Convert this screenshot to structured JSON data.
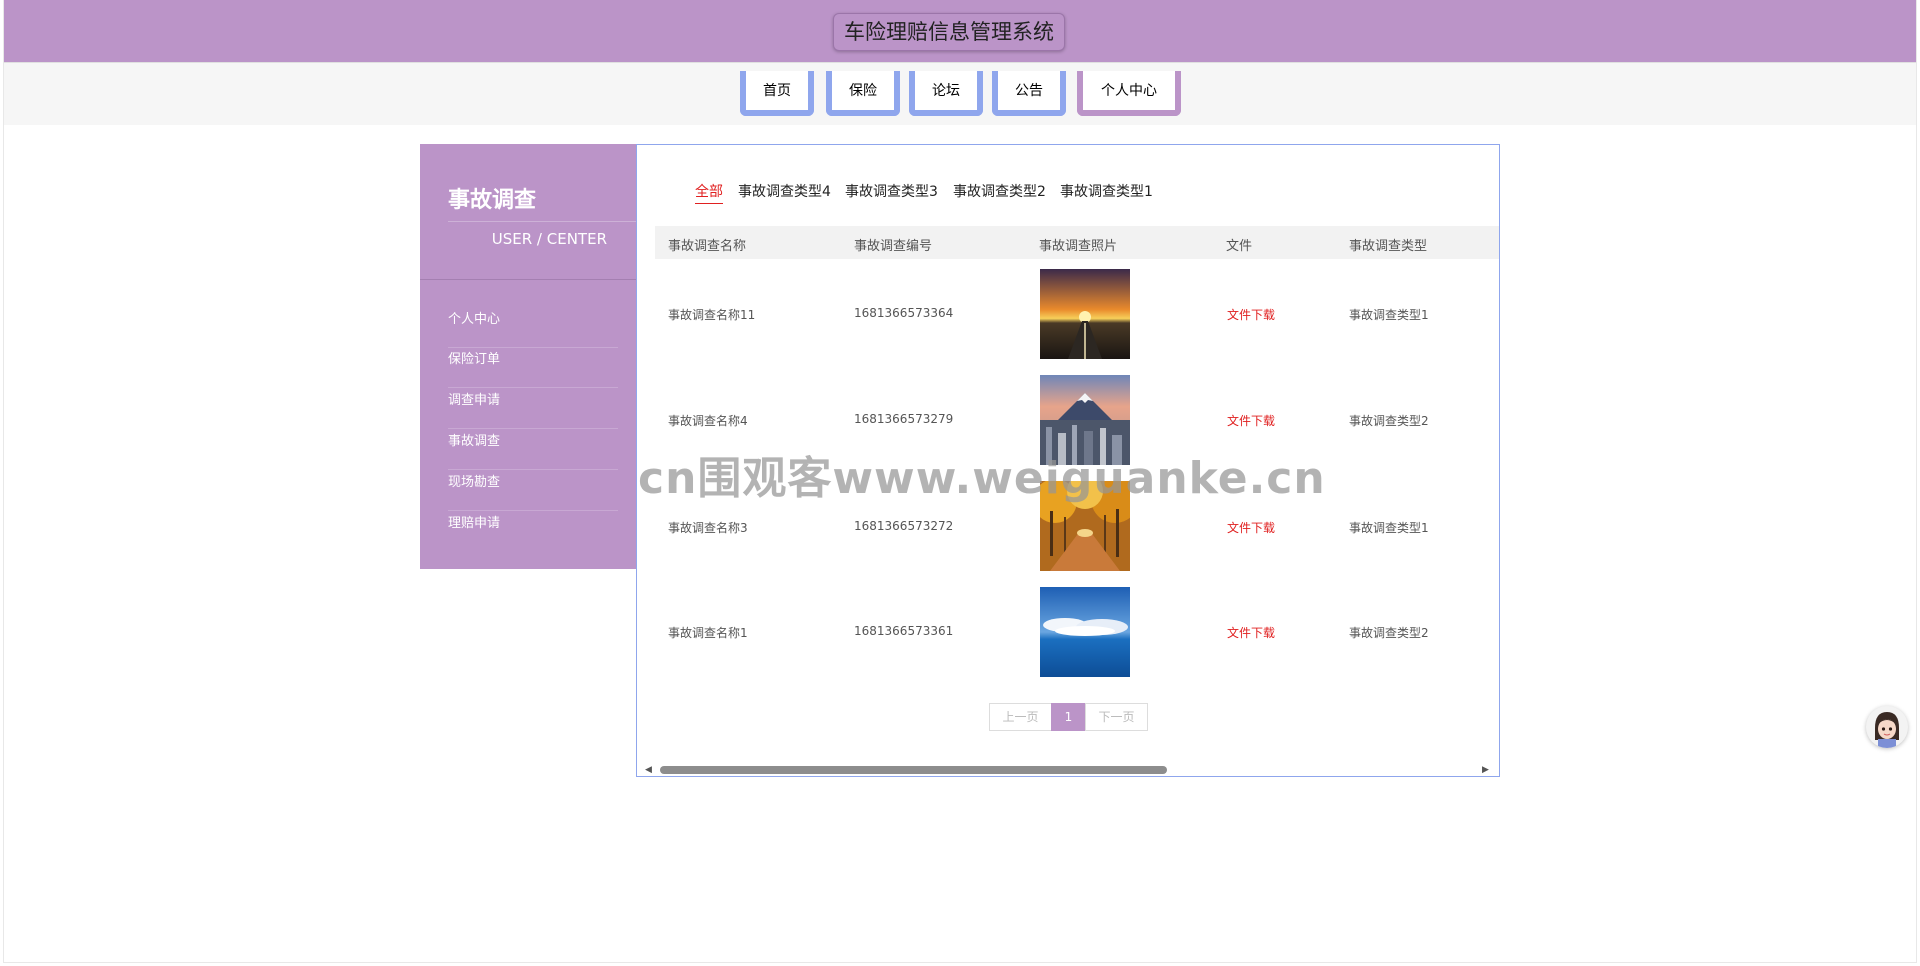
{
  "header": {
    "title": "车险理赔信息管理系统"
  },
  "nav": {
    "items": [
      "首页",
      "保险",
      "论坛",
      "公告",
      "个人中心"
    ],
    "active_index": 4
  },
  "sidebar": {
    "title": "事故调查",
    "subtitle": "USER / CENTER",
    "items": [
      "个人中心",
      "保险订单",
      "调查申请",
      "事故调查",
      "现场勘查",
      "理赔申请"
    ]
  },
  "tabs": {
    "items": [
      "全部",
      "事故调查类型4",
      "事故调查类型3",
      "事故调查类型2",
      "事故调查类型1"
    ],
    "active_index": 0
  },
  "table": {
    "headers": [
      "事故调查名称",
      "事故调查编号",
      "事故调查照片",
      "文件",
      "事故调查类型"
    ],
    "rows": [
      {
        "name": "事故调查名称11",
        "code": "1681366573364",
        "file": "文件下载",
        "type": "事故调查类型1",
        "photo": "sunset-road"
      },
      {
        "name": "事故调查名称4",
        "code": "1681366573279",
        "file": "文件下载",
        "type": "事故调查类型2",
        "photo": "mountain-city"
      },
      {
        "name": "事故调查名称3",
        "code": "1681366573272",
        "file": "文件下载",
        "type": "事故调查类型1",
        "photo": "autumn-trees"
      },
      {
        "name": "事故调查名称1",
        "code": "1681366573361",
        "file": "文件下载",
        "type": "事故调查类型2",
        "photo": "sky-sea"
      }
    ]
  },
  "pagination": {
    "prev": "上一页",
    "current": "1",
    "next": "下一页"
  },
  "watermark": "cn围观客www.weiguanke.cn",
  "colors": {
    "theme": "#bb94c8",
    "nav_border": "#8fa6ed",
    "link_red": "#e02020"
  }
}
